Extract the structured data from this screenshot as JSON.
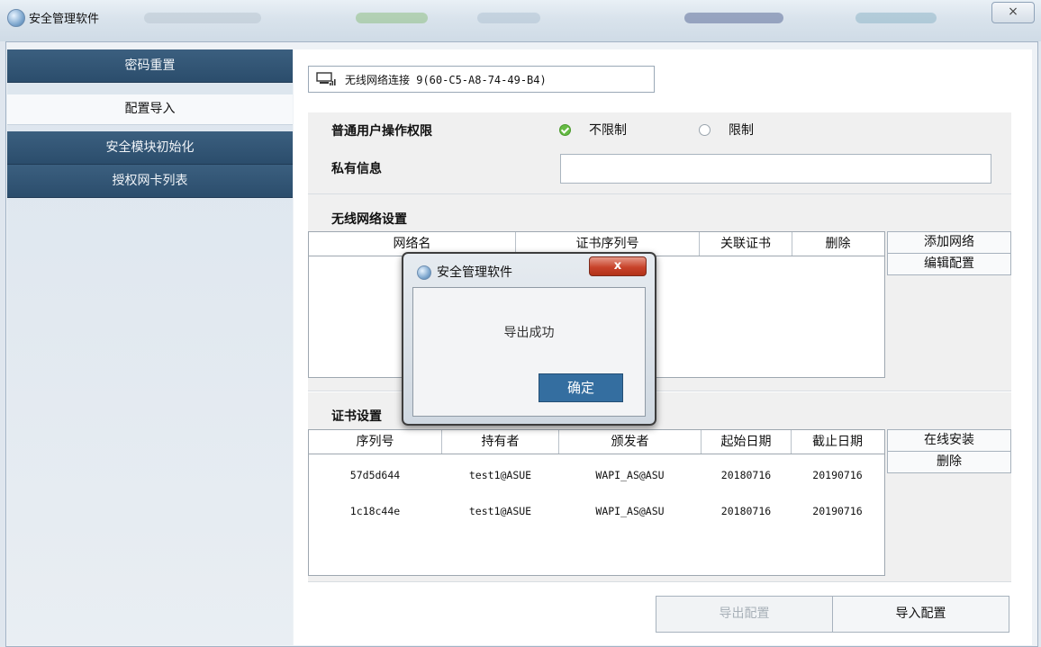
{
  "window": {
    "title": "安全管理软件",
    "close_icon": "×"
  },
  "nav": {
    "items": [
      {
        "label": "密码重置"
      },
      {
        "label": "配置导入"
      },
      {
        "label": "安全模块初始化"
      },
      {
        "label": "授权网卡列表"
      }
    ],
    "active_index": 1
  },
  "connection": {
    "icon": "network-adapter-icon",
    "label": "无线网络连接 9(60-C5-A8-74-49-B4)"
  },
  "permissions": {
    "label": "普通用户操作权限",
    "options": [
      {
        "label": "不限制",
        "selected": true
      },
      {
        "label": "限制",
        "selected": false
      }
    ],
    "selected_color": "#66bb44"
  },
  "private_info": {
    "label": "私有信息",
    "value": ""
  },
  "wireless": {
    "title": "无线网络设置",
    "columns": [
      "网络名",
      "证书序列号",
      "关联证书",
      "删除"
    ],
    "rows": [],
    "buttons": {
      "add": "添加网络",
      "edit": "编辑配置"
    }
  },
  "certs": {
    "title": "证书设置",
    "columns": [
      "序列号",
      "持有者",
      "颁发者",
      "起始日期",
      "截止日期"
    ],
    "rows": [
      [
        "57d5d644",
        "test1@ASUE",
        "WAPI_AS@ASU",
        "20180716",
        "20190716"
      ],
      [
        "1c18c44e",
        "test1@ASUE",
        "WAPI_AS@ASU",
        "20180716",
        "20190716"
      ]
    ],
    "buttons": {
      "install": "在线安装",
      "delete": "删除"
    }
  },
  "bottom": {
    "export_label": "导出配置",
    "import_label": "导入配置"
  },
  "dialog": {
    "title": "安全管理软件",
    "close_icon": "x",
    "message": "导出成功",
    "ok_label": "确定",
    "ok_color": "#346ea0"
  }
}
